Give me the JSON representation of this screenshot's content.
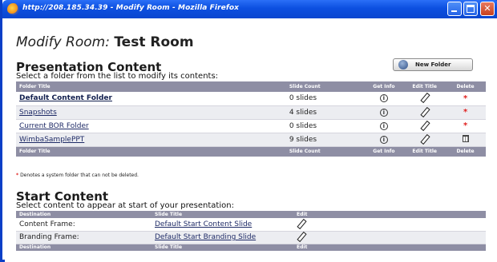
{
  "window": {
    "title": "http://208.185.34.39 - Modify Room - Mozilla Firefox"
  },
  "page": {
    "title_prefix": "Modify Room:",
    "room_name": "Test Room"
  },
  "presentation": {
    "heading": "Presentation Content",
    "instructions": "Select a folder from the list to modify its contents:",
    "new_folder_label": "New Folder",
    "columns": {
      "folder_title": "Folder Title",
      "slide_count": "Slide Count",
      "get_info": "Get Info",
      "edit_title": "Edit Title",
      "delete": "Delete"
    },
    "rows": [
      {
        "title": "Default Content Folder",
        "slides": "0 slides",
        "system": true
      },
      {
        "title": "Snapshots",
        "slides": "4 slides",
        "system": true
      },
      {
        "title": "Current BOR Folder",
        "slides": "0 slides",
        "system": true
      },
      {
        "title": "WimbaSamplePPT",
        "slides": "9 slides",
        "system": false
      }
    ],
    "delete_mark": "*",
    "note_star": "*",
    "note": "Denotes a system folder that can not be deleted."
  },
  "start": {
    "heading": "Start Content",
    "instructions": "Select content to appear at start of your presentation:",
    "columns": {
      "destination": "Destination",
      "slide_title": "Slide Title",
      "edit": "Edit"
    },
    "rows": [
      {
        "destination": "Content Frame:",
        "slide": "Default Start Content Slide"
      },
      {
        "destination": "Branding Frame:",
        "slide": "Default Start Branding Slide"
      }
    ]
  },
  "icons": {
    "info": "info-icon",
    "edit": "pencil-icon",
    "delete_locked": "red-asterisk",
    "delete": "trash-icon"
  },
  "colors": {
    "titlebar": "#0c4fe0",
    "table_header": "#8e8ea4",
    "delete_mark": "#e0201e"
  }
}
